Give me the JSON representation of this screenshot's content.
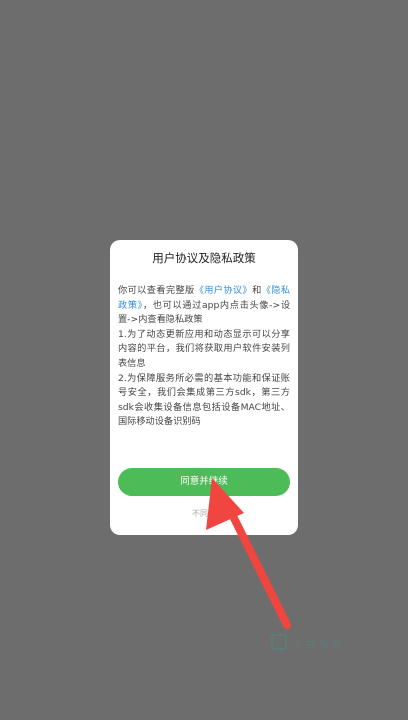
{
  "dialog": {
    "title": "用户协议及隐私政策",
    "para1_prefix": "你可以查看完整版",
    "user_agreement_link": "《用户协议》",
    "para1_and": "和",
    "privacy_policy_link": "《隐私政策》",
    "para1_suffix": "，也可以通过app内点击头像->设置->内查看隐私政策",
    "para2": "1.为了动态更新应用和动态显示可以分享内容的平台，我们将获取用户软件安装列表信息",
    "para3": "2.为保障服务所必需的基本功能和保证账号安全，我们会集成第三方sdk，第三方sdk会收集设备信息包括设备MAC地址、国际移动设备识别码",
    "agree_label": "同意并继续",
    "disagree_label": "不同意"
  },
  "watermark": {
    "text": "小白系统"
  },
  "colors": {
    "backdrop": "#6d6d6d",
    "accent_green": "#4dbb58",
    "link_blue": "#2f8ee0",
    "arrow_red": "#f0463f"
  },
  "icons": {
    "pointer_arrow": "red-arrow-icon",
    "watermark_logo": "watermark-logo-icon"
  }
}
